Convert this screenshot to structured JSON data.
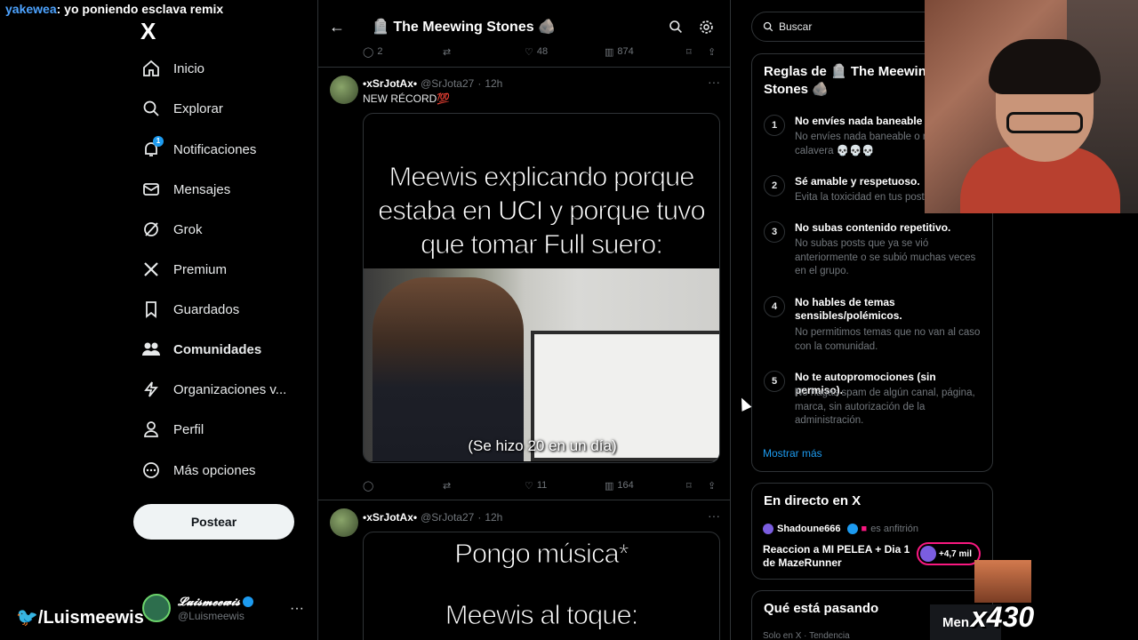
{
  "stream": {
    "chat_user": "yakewea",
    "chat_message": ": yo poniendo esclava remix",
    "corner_tag": "/Luismeewis",
    "counter": "x430",
    "menu_label": "Men"
  },
  "nav": {
    "logo": "X",
    "items": [
      {
        "label": "Inicio",
        "icon": "home-icon"
      },
      {
        "label": "Explorar",
        "icon": "search-icon"
      },
      {
        "label": "Notificaciones",
        "icon": "bell-icon",
        "badge": "1"
      },
      {
        "label": "Mensajes",
        "icon": "mail-icon"
      },
      {
        "label": "Grok",
        "icon": "grok-icon"
      },
      {
        "label": "Premium",
        "icon": "x-icon"
      },
      {
        "label": "Guardados",
        "icon": "bookmark-icon"
      },
      {
        "label": "Comunidades",
        "icon": "communities-icon"
      },
      {
        "label": "Organizaciones v...",
        "icon": "lightning-icon"
      },
      {
        "label": "Perfil",
        "icon": "person-icon"
      },
      {
        "label": "Más opciones",
        "icon": "more-circle-icon"
      }
    ],
    "post_button": "Postear",
    "account": {
      "name": "𝓛𝓾𝓲𝓼𝓶𝓮𝓮𝔀𝓲𝓼",
      "handle": "@Luismeewis"
    }
  },
  "community": {
    "title": "🪦 The Meewing Stones 🪨"
  },
  "tweets": [
    {
      "actions": {
        "replies": "2",
        "retweets": "",
        "likes": "48",
        "views": "874"
      }
    },
    {
      "name": "•xSrJotAx•",
      "handle": "@SrJota27",
      "time": "12h",
      "text": "NEW RÉCORD💯",
      "meme_caption": "Meewis explicando porque estaba  en UCI y porque tuvo que tomar Full suero:",
      "video_subtitle": "(Se hizo 20 en un día)",
      "actions": {
        "replies": "",
        "retweets": "",
        "likes": "11",
        "views": "164"
      }
    },
    {
      "name": "•xSrJotAx•",
      "handle": "@SrJota27",
      "time": "12h",
      "meme_line1": "Pongo música*",
      "meme_line2": "Meewis al toque:"
    }
  ],
  "right": {
    "search_placeholder": "Buscar",
    "rules_title_1": "Reglas de 🪦 The Meewing",
    "rules_title_2": "Stones 🪨",
    "rules": [
      {
        "n": "1",
        "title": "No envíes nada baneable",
        "desc": "No envíes nada baneable o necesitarás calavera 💀💀💀"
      },
      {
        "n": "2",
        "title": "Sé amable y respetuoso.",
        "desc": "Evita la toxicidad en tus posts."
      },
      {
        "n": "3",
        "title": "No subas contenido repetitivo.",
        "desc": "No subas posts que ya se vió anteriormente o se subió muchas veces en el grupo."
      },
      {
        "n": "4",
        "title": "No hables de temas sensibles/polémicos.",
        "desc": "No permitimos temas que no van al caso con la comunidad."
      },
      {
        "n": "5",
        "title": "No te autopromociones (sin permiso).",
        "desc": "No hagas spam de algún canal, página, marca, sin autorización de la administración."
      }
    ],
    "show_more": "Mostrar más",
    "live_title": "En directo en X",
    "live_host": "Shadoune666",
    "live_role": "es anfitrión",
    "live_stream_title": "Reaccion a MI PELEA + Dia 1 de MazeRunner",
    "live_count": "+4,7 mil",
    "trends_title": "Qué está pasando",
    "trends_sub": "Solo en X · Tendencia"
  },
  "colors": {
    "accent": "#1d9bf0",
    "live": "#f91880",
    "background": "#000000"
  }
}
